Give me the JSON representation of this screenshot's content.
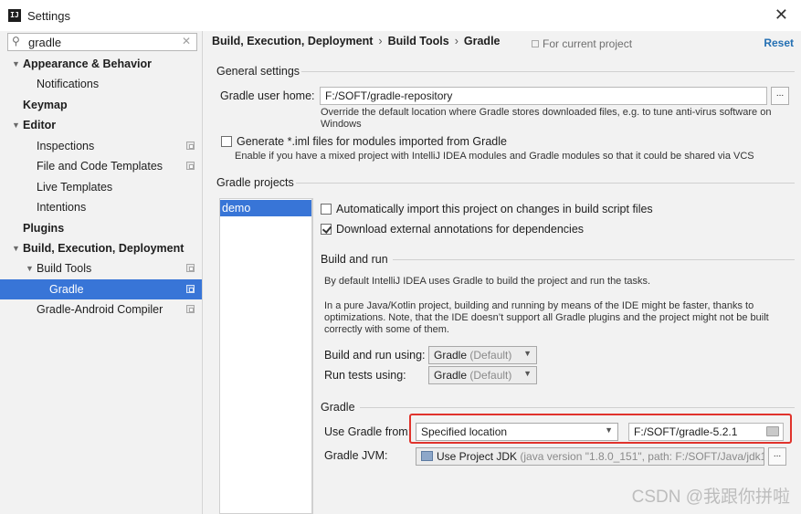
{
  "window": {
    "title": "Settings",
    "app_icon": "IJ"
  },
  "search": {
    "value": "gradle",
    "icon": "search-icon",
    "clear_icon": "close-icon"
  },
  "sidebar": {
    "items": [
      {
        "label": "Appearance & Behavior",
        "expanded": true
      },
      {
        "label": "Notifications"
      },
      {
        "label": "Keymap"
      },
      {
        "label": "Editor",
        "expanded": true
      },
      {
        "label": "Inspections"
      },
      {
        "label": "File and Code Templates"
      },
      {
        "label": "Live Templates"
      },
      {
        "label": "Intentions"
      },
      {
        "label": "Plugins"
      },
      {
        "label": "Build, Execution, Deployment",
        "expanded": true
      },
      {
        "label": "Build Tools",
        "expanded": true
      },
      {
        "label": "Gradle",
        "selected": true
      },
      {
        "label": "Gradle-Android Compiler"
      }
    ]
  },
  "header": {
    "breadcrumb": [
      "Build, Execution, Deployment",
      "Build Tools",
      "Gradle"
    ],
    "breadcrumb_sep": "›",
    "scope_label": "For current project",
    "reset_label": "Reset"
  },
  "general": {
    "title": "General settings",
    "home_label": "Gradle user home:",
    "home_value": "F:/SOFT/gradle-repository",
    "browse_label": "...",
    "home_hint_1": "Override the default location where Gradle stores downloaded files, e.g. to tune anti-virus software on",
    "home_hint_2": "Windows",
    "generate_iml_label": "Generate *.iml files for modules imported from Gradle",
    "generate_iml_checked": false,
    "generate_iml_hint": "Enable if you have a mixed project with IntelliJ IDEA modules and Gradle modules so that it could be shared via VCS"
  },
  "projects": {
    "title": "Gradle projects",
    "list": [
      "demo"
    ],
    "auto_import_label": "Automatically import this project on changes in build script files",
    "auto_import_checked": false,
    "download_annotations_label": "Download external annotations for dependencies",
    "download_annotations_checked": true
  },
  "build_run": {
    "title": "Build and run",
    "desc_1": "By default IntelliJ IDEA uses Gradle to build the project and run the tasks.",
    "desc_2": "In a pure Java/Kotlin project, building and running by means of the IDE might be faster, thanks to",
    "desc_3": "optimizations. Note, that the IDE doesn’t support all Gradle plugins and the project might not be built",
    "desc_4": "correctly with some of them.",
    "build_using_label": "Build and run using:",
    "build_using_value": "Gradle",
    "build_using_suffix": "(Default)",
    "tests_using_label": "Run tests using:",
    "tests_using_value": "Gradle",
    "tests_using_suffix": "(Default)"
  },
  "gradle": {
    "title": "Gradle",
    "use_from_label": "Use Gradle from:",
    "use_from_value": "Specified location",
    "location_value": "F:/SOFT/gradle-5.2.1",
    "jvm_label": "Gradle JVM:",
    "jvm_value": "Use Project JDK",
    "jvm_detail": "(java version \"1.8.0_151\", path: F:/SOFT/Java/jdk1.",
    "jvm_browse_label": "..."
  },
  "watermark": "CSDN @我跟你拼啦",
  "colors": {
    "selection": "#3875d7",
    "link": "#2470b3",
    "highlight_box": "#e0332c"
  }
}
